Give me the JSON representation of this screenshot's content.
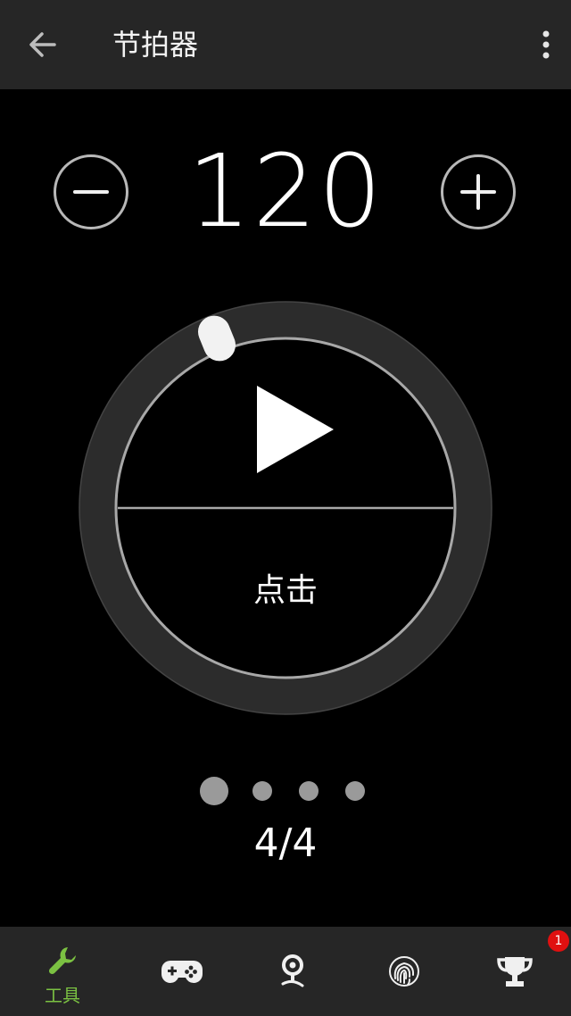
{
  "header": {
    "title": "节拍器"
  },
  "tempo": {
    "bpm": "120",
    "minus_symbol": "−",
    "plus_symbol": "+"
  },
  "dial": {
    "tap_label": "点击"
  },
  "beats": {
    "count_label": "4/4",
    "total": 4,
    "current": 1
  },
  "bottom_nav": {
    "items": [
      {
        "icon": "wrench-icon",
        "label": "工具",
        "active": true
      },
      {
        "icon": "gamepad-icon",
        "label": "",
        "active": false
      },
      {
        "icon": "location-pin-icon",
        "label": "",
        "active": false
      },
      {
        "icon": "fingerprint-icon",
        "label": "",
        "active": false
      },
      {
        "icon": "trophy-icon",
        "label": "",
        "active": false
      }
    ],
    "trophy_badge": "1"
  },
  "colors": {
    "bar_background": "#262626",
    "accent_green": "#7bc142",
    "badge_red": "#e01010",
    "ring_gray": "#2c2c2c"
  }
}
